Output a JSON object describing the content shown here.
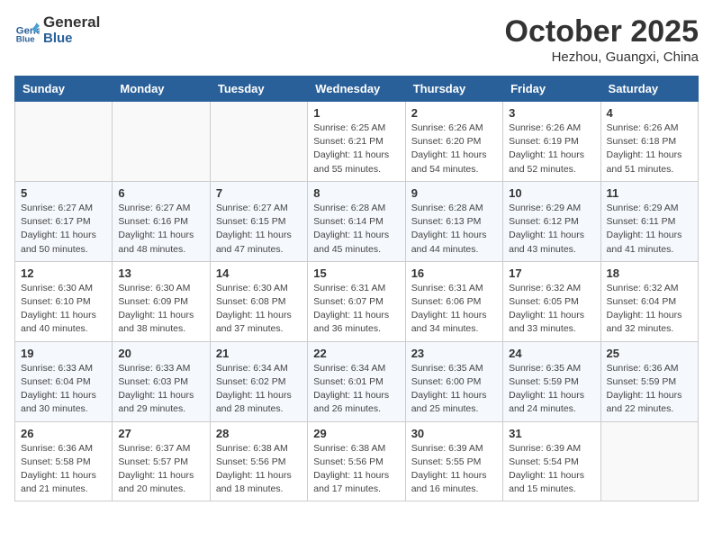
{
  "header": {
    "logo_line1": "General",
    "logo_line2": "Blue",
    "month": "October 2025",
    "location": "Hezhou, Guangxi, China"
  },
  "weekdays": [
    "Sunday",
    "Monday",
    "Tuesday",
    "Wednesday",
    "Thursday",
    "Friday",
    "Saturday"
  ],
  "weeks": [
    [
      {
        "day": "",
        "info": ""
      },
      {
        "day": "",
        "info": ""
      },
      {
        "day": "",
        "info": ""
      },
      {
        "day": "1",
        "info": "Sunrise: 6:25 AM\nSunset: 6:21 PM\nDaylight: 11 hours\nand 55 minutes."
      },
      {
        "day": "2",
        "info": "Sunrise: 6:26 AM\nSunset: 6:20 PM\nDaylight: 11 hours\nand 54 minutes."
      },
      {
        "day": "3",
        "info": "Sunrise: 6:26 AM\nSunset: 6:19 PM\nDaylight: 11 hours\nand 52 minutes."
      },
      {
        "day": "4",
        "info": "Sunrise: 6:26 AM\nSunset: 6:18 PM\nDaylight: 11 hours\nand 51 minutes."
      }
    ],
    [
      {
        "day": "5",
        "info": "Sunrise: 6:27 AM\nSunset: 6:17 PM\nDaylight: 11 hours\nand 50 minutes."
      },
      {
        "day": "6",
        "info": "Sunrise: 6:27 AM\nSunset: 6:16 PM\nDaylight: 11 hours\nand 48 minutes."
      },
      {
        "day": "7",
        "info": "Sunrise: 6:27 AM\nSunset: 6:15 PM\nDaylight: 11 hours\nand 47 minutes."
      },
      {
        "day": "8",
        "info": "Sunrise: 6:28 AM\nSunset: 6:14 PM\nDaylight: 11 hours\nand 45 minutes."
      },
      {
        "day": "9",
        "info": "Sunrise: 6:28 AM\nSunset: 6:13 PM\nDaylight: 11 hours\nand 44 minutes."
      },
      {
        "day": "10",
        "info": "Sunrise: 6:29 AM\nSunset: 6:12 PM\nDaylight: 11 hours\nand 43 minutes."
      },
      {
        "day": "11",
        "info": "Sunrise: 6:29 AM\nSunset: 6:11 PM\nDaylight: 11 hours\nand 41 minutes."
      }
    ],
    [
      {
        "day": "12",
        "info": "Sunrise: 6:30 AM\nSunset: 6:10 PM\nDaylight: 11 hours\nand 40 minutes."
      },
      {
        "day": "13",
        "info": "Sunrise: 6:30 AM\nSunset: 6:09 PM\nDaylight: 11 hours\nand 38 minutes."
      },
      {
        "day": "14",
        "info": "Sunrise: 6:30 AM\nSunset: 6:08 PM\nDaylight: 11 hours\nand 37 minutes."
      },
      {
        "day": "15",
        "info": "Sunrise: 6:31 AM\nSunset: 6:07 PM\nDaylight: 11 hours\nand 36 minutes."
      },
      {
        "day": "16",
        "info": "Sunrise: 6:31 AM\nSunset: 6:06 PM\nDaylight: 11 hours\nand 34 minutes."
      },
      {
        "day": "17",
        "info": "Sunrise: 6:32 AM\nSunset: 6:05 PM\nDaylight: 11 hours\nand 33 minutes."
      },
      {
        "day": "18",
        "info": "Sunrise: 6:32 AM\nSunset: 6:04 PM\nDaylight: 11 hours\nand 32 minutes."
      }
    ],
    [
      {
        "day": "19",
        "info": "Sunrise: 6:33 AM\nSunset: 6:04 PM\nDaylight: 11 hours\nand 30 minutes."
      },
      {
        "day": "20",
        "info": "Sunrise: 6:33 AM\nSunset: 6:03 PM\nDaylight: 11 hours\nand 29 minutes."
      },
      {
        "day": "21",
        "info": "Sunrise: 6:34 AM\nSunset: 6:02 PM\nDaylight: 11 hours\nand 28 minutes."
      },
      {
        "day": "22",
        "info": "Sunrise: 6:34 AM\nSunset: 6:01 PM\nDaylight: 11 hours\nand 26 minutes."
      },
      {
        "day": "23",
        "info": "Sunrise: 6:35 AM\nSunset: 6:00 PM\nDaylight: 11 hours\nand 25 minutes."
      },
      {
        "day": "24",
        "info": "Sunrise: 6:35 AM\nSunset: 5:59 PM\nDaylight: 11 hours\nand 24 minutes."
      },
      {
        "day": "25",
        "info": "Sunrise: 6:36 AM\nSunset: 5:59 PM\nDaylight: 11 hours\nand 22 minutes."
      }
    ],
    [
      {
        "day": "26",
        "info": "Sunrise: 6:36 AM\nSunset: 5:58 PM\nDaylight: 11 hours\nand 21 minutes."
      },
      {
        "day": "27",
        "info": "Sunrise: 6:37 AM\nSunset: 5:57 PM\nDaylight: 11 hours\nand 20 minutes."
      },
      {
        "day": "28",
        "info": "Sunrise: 6:38 AM\nSunset: 5:56 PM\nDaylight: 11 hours\nand 18 minutes."
      },
      {
        "day": "29",
        "info": "Sunrise: 6:38 AM\nSunset: 5:56 PM\nDaylight: 11 hours\nand 17 minutes."
      },
      {
        "day": "30",
        "info": "Sunrise: 6:39 AM\nSunset: 5:55 PM\nDaylight: 11 hours\nand 16 minutes."
      },
      {
        "day": "31",
        "info": "Sunrise: 6:39 AM\nSunset: 5:54 PM\nDaylight: 11 hours\nand 15 minutes."
      },
      {
        "day": "",
        "info": ""
      }
    ]
  ]
}
